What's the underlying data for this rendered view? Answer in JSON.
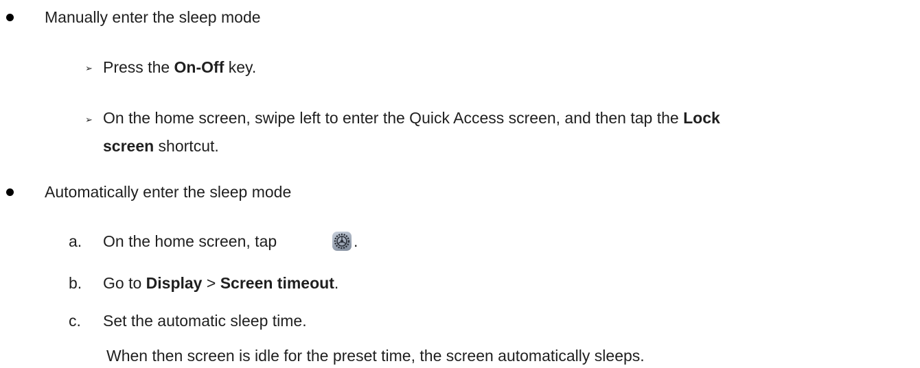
{
  "items": [
    {
      "text": "Manually enter the sleep mode",
      "steps": [
        {
          "parts": [
            "Press the ",
            "On-Off",
            " key."
          ]
        },
        {
          "parts": [
            "On the home screen, swipe left to enter the Quick Access screen, and then tap the ",
            "Lock",
            "screen",
            " shortcut."
          ]
        }
      ]
    },
    {
      "text": "Automatically enter the sleep mode",
      "steps": [
        {
          "marker": "a.",
          "text": "On the home screen, tap",
          "icon": "settings-gear-icon",
          "after": "."
        },
        {
          "marker": "b.",
          "parts": [
            "Go to ",
            "Display",
            " > ",
            "Screen timeout",
            "."
          ]
        },
        {
          "marker": "c.",
          "text": "Set the automatic sleep time."
        },
        {
          "note": "When then screen is idle for the preset time, the screen automatically sleeps."
        }
      ]
    }
  ]
}
